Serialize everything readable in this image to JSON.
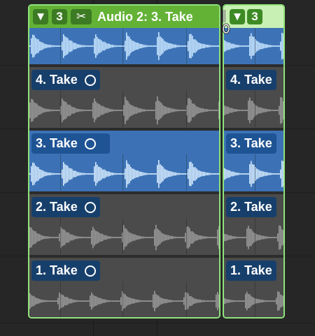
{
  "colors": {
    "folder_border": "#8fe27a",
    "header_green": "#63b236",
    "header_green_light": "#c9f0b4",
    "selected_lane": "#3c72b5",
    "lane_gray": "#4b4b4b",
    "wave_selected": "#d6ebff",
    "wave_gray": "#9a9a9a",
    "tag_blue": "#173f6b"
  },
  "folder_a": {
    "disclosure_icon": "triangle-down-icon",
    "disclosure_symbol": "▼",
    "take_count": "3",
    "quick_swipe_icon": "scissors-icon",
    "scissor_symbol": "✂",
    "title": "Audio 2: 3. Take",
    "takes": [
      {
        "label": "4. Take",
        "selected": false
      },
      {
        "label": "3. Take",
        "selected": true
      },
      {
        "label": "2. Take",
        "selected": false
      },
      {
        "label": "1. Take",
        "selected": false
      }
    ]
  },
  "folder_b": {
    "disclosure_icon": "triangle-down-icon",
    "disclosure_symbol": "▼",
    "take_count": "3",
    "takes": [
      {
        "label": "4. Take",
        "selected": false
      },
      {
        "label": "3. Take",
        "selected": true
      },
      {
        "label": "2. Take",
        "selected": false
      },
      {
        "label": "1. Take",
        "selected": false
      }
    ]
  }
}
